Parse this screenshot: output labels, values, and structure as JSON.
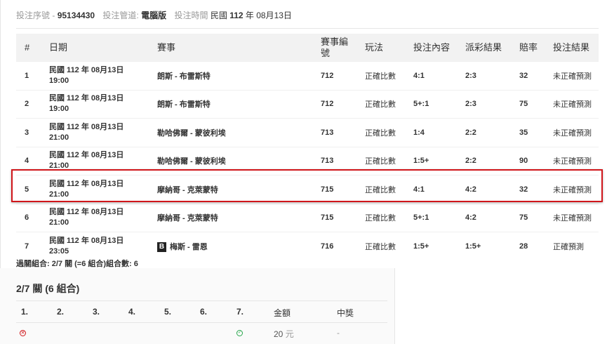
{
  "meta": {
    "serial_label": "投注序號 -",
    "serial_value": "95134430",
    "channel_label": "投注管道:",
    "channel_value": "電腦版",
    "time_label": "投注時間",
    "time_prefix": "民國",
    "time_year": "112",
    "time_rest": "年 08月13日"
  },
  "table": {
    "headers": [
      "#",
      "日期",
      "賽事",
      "賽事編號",
      "玩法",
      "投注內容",
      "派彩結果",
      "賠率",
      "投注結果"
    ],
    "rows": [
      {
        "idx": "1",
        "date1": "民國 112 年 08月13日",
        "date2": "19:00",
        "match": "朗斯 - 布雷斯特",
        "badge": "",
        "code": "712",
        "play": "正確比數",
        "pick": "4:1",
        "result": "2:3",
        "odds": "32",
        "outcome": "未正確預測"
      },
      {
        "idx": "2",
        "date1": "民國 112 年 08月13日",
        "date2": "19:00",
        "match": "朗斯 - 布雷斯特",
        "badge": "",
        "code": "712",
        "play": "正確比數",
        "pick": "5+:1",
        "result": "2:3",
        "odds": "75",
        "outcome": "未正確預測"
      },
      {
        "idx": "3",
        "date1": "民國 112 年 08月13日",
        "date2": "21:00",
        "match": "勒哈佛爾 - 蒙彼利埃",
        "badge": "",
        "code": "713",
        "play": "正確比數",
        "pick": "1:4",
        "result": "2:2",
        "odds": "35",
        "outcome": "未正確預測"
      },
      {
        "idx": "4",
        "date1": "民國 112 年 08月13日",
        "date2": "21:00",
        "match": "勒哈佛爾 - 蒙彼利埃",
        "badge": "",
        "code": "713",
        "play": "正確比數",
        "pick": "1:5+",
        "result": "2:2",
        "odds": "90",
        "outcome": "未正確預測"
      },
      {
        "idx": "5",
        "date1": "民國 112 年 08月13日",
        "date2": "21:00",
        "match": "摩納哥 - 克萊蒙特",
        "badge": "",
        "code": "715",
        "play": "正確比數",
        "pick": "4:1",
        "result": "4:2",
        "odds": "32",
        "outcome": "未正確預測"
      },
      {
        "idx": "6",
        "date1": "民國 112 年 08月13日",
        "date2": "21:00",
        "match": "摩納哥 - 克萊蒙特",
        "badge": "",
        "code": "715",
        "play": "正確比數",
        "pick": "5+:1",
        "result": "4:2",
        "odds": "75",
        "outcome": "未正確預測"
      },
      {
        "idx": "7",
        "date1": "民國 112 年 08月13日",
        "date2": "23:05",
        "match": "梅斯 - 雷恩",
        "badge": "B",
        "code": "716",
        "play": "正確比數",
        "pick": "1:5+",
        "result": "1:5+",
        "odds": "28",
        "outcome": "正確預測"
      }
    ]
  },
  "combo_summary": "過關組合: 2/7 關 (=6 組合)組合數: 6",
  "panel": {
    "title": "2/7 關 (6 組合)",
    "headers": [
      "1.",
      "2.",
      "3.",
      "4.",
      "5.",
      "6.",
      "7.",
      "金額",
      "中獎"
    ],
    "row": {
      "x_mark": "✕",
      "ok_mark": "✓",
      "amount": "20",
      "unit": "元",
      "prize": "-"
    }
  },
  "colors": {
    "highlight": "#d0161b",
    "header_bg": "#f2f2f2",
    "ok": "#26a64a"
  }
}
